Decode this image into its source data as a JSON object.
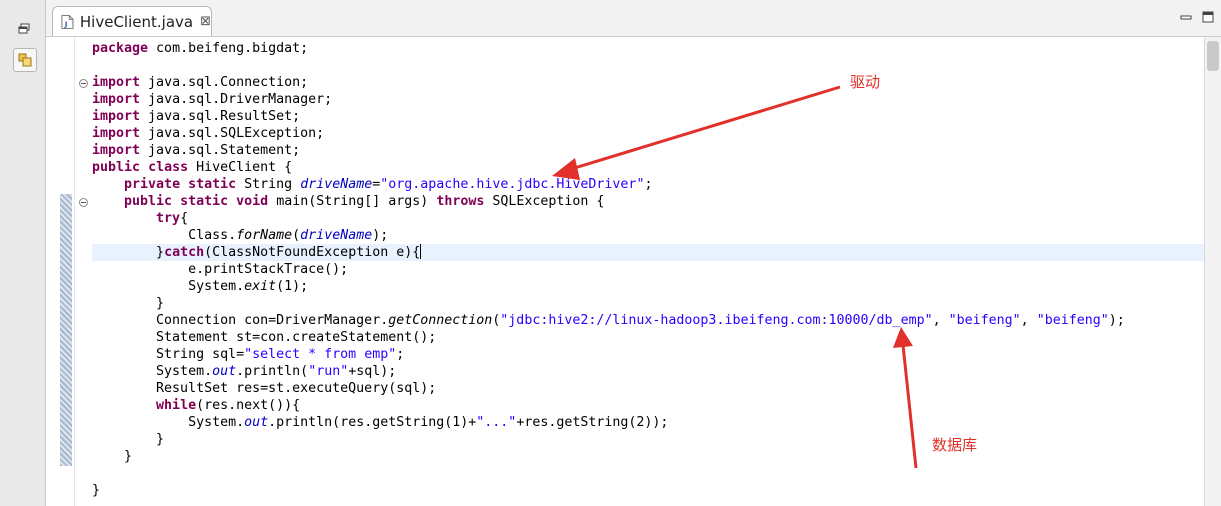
{
  "left_toolbar": {
    "buttons": [
      {
        "name": "restore-icon"
      },
      {
        "name": "packages-icon"
      }
    ]
  },
  "tab": {
    "title": "HiveClient.java",
    "close_glyph": "⊠",
    "icon": "java-file-icon"
  },
  "window_buttons": [
    "minimize-icon",
    "maximize-icon"
  ],
  "code_lines": [
    [
      {
        "t": "package",
        "c": "kw"
      },
      {
        "t": " com.beifeng.bigdat;"
      }
    ],
    [],
    [
      {
        "t": "import",
        "c": "kw"
      },
      {
        "t": " java.sql.Connection;"
      }
    ],
    [
      {
        "t": "import",
        "c": "kw"
      },
      {
        "t": " java.sql.DriverManager;"
      }
    ],
    [
      {
        "t": "import",
        "c": "kw"
      },
      {
        "t": " java.sql.ResultSet;"
      }
    ],
    [
      {
        "t": "import",
        "c": "kw"
      },
      {
        "t": " java.sql.SQLException;"
      }
    ],
    [
      {
        "t": "import",
        "c": "kw"
      },
      {
        "t": " java.sql.Statement;"
      }
    ],
    [
      {
        "t": "public",
        "c": "kw"
      },
      {
        "t": " "
      },
      {
        "t": "class",
        "c": "kw"
      },
      {
        "t": " HiveClient {"
      }
    ],
    [
      {
        "t": "    "
      },
      {
        "t": "private",
        "c": "kw"
      },
      {
        "t": " "
      },
      {
        "t": "static",
        "c": "kw"
      },
      {
        "t": " String "
      },
      {
        "t": "driveName",
        "c": "fld"
      },
      {
        "t": "="
      },
      {
        "t": "\"org.apache.hive.jdbc.HiveDriver\"",
        "c": "str"
      },
      {
        "t": ";"
      }
    ],
    [
      {
        "t": "    "
      },
      {
        "t": "public",
        "c": "kw"
      },
      {
        "t": " "
      },
      {
        "t": "static",
        "c": "kw"
      },
      {
        "t": " "
      },
      {
        "t": "void",
        "c": "kw"
      },
      {
        "t": " main(String[] args) "
      },
      {
        "t": "throws",
        "c": "kw"
      },
      {
        "t": " SQLException {"
      }
    ],
    [
      {
        "t": "        "
      },
      {
        "t": "try",
        "c": "kw"
      },
      {
        "t": "{"
      }
    ],
    [
      {
        "t": "            Class."
      },
      {
        "t": "forName",
        "c": "it"
      },
      {
        "t": "("
      },
      {
        "t": "driveName",
        "c": "fld"
      },
      {
        "t": ");"
      }
    ],
    [
      {
        "t": "        }"
      },
      {
        "t": "catch",
        "c": "kw"
      },
      {
        "t": "(ClassNotFoundException e){"
      },
      {
        "t": "",
        "c": "caret"
      }
    ],
    [
      {
        "t": "            e.printStackTrace();"
      }
    ],
    [
      {
        "t": "            System."
      },
      {
        "t": "exit",
        "c": "it"
      },
      {
        "t": "(1);"
      }
    ],
    [
      {
        "t": "        }"
      }
    ],
    [
      {
        "t": "        Connection con=DriverManager."
      },
      {
        "t": "getConnection",
        "c": "it"
      },
      {
        "t": "("
      },
      {
        "t": "\"jdbc:hive2://linux-hadoop3.ibeifeng.com:10000/db_emp\"",
        "c": "str"
      },
      {
        "t": ", "
      },
      {
        "t": "\"beifeng\"",
        "c": "str"
      },
      {
        "t": ", "
      },
      {
        "t": "\"beifeng\"",
        "c": "str"
      },
      {
        "t": ");"
      }
    ],
    [
      {
        "t": "        Statement st=con.createStatement();"
      }
    ],
    [
      {
        "t": "        String sql="
      },
      {
        "t": "\"select * from emp\"",
        "c": "str"
      },
      {
        "t": ";"
      }
    ],
    [
      {
        "t": "        System."
      },
      {
        "t": "out",
        "c": "fld"
      },
      {
        "t": ".println("
      },
      {
        "t": "\"run\"",
        "c": "str"
      },
      {
        "t": "+sql);"
      }
    ],
    [
      {
        "t": "        ResultSet res=st.executeQuery(sql);"
      }
    ],
    [
      {
        "t": "        "
      },
      {
        "t": "while",
        "c": "kw"
      },
      {
        "t": "(res.next()){"
      }
    ],
    [
      {
        "t": "            System."
      },
      {
        "t": "out",
        "c": "fld"
      },
      {
        "t": ".println(res.getString(1)+"
      },
      {
        "t": "\"...\"",
        "c": "str"
      },
      {
        "t": "+res.getString(2));"
      }
    ],
    [
      {
        "t": "        }"
      }
    ],
    [
      {
        "t": "    }"
      }
    ],
    [],
    [
      {
        "t": "}"
      }
    ]
  ],
  "annotations": {
    "driver": "驱动",
    "database": "数据库",
    "color": "#e2302a"
  },
  "colors": {
    "keyword": "#7f0055",
    "string": "#2a00ff",
    "field": "#0000c0",
    "current_line": "#e8f2fe"
  }
}
